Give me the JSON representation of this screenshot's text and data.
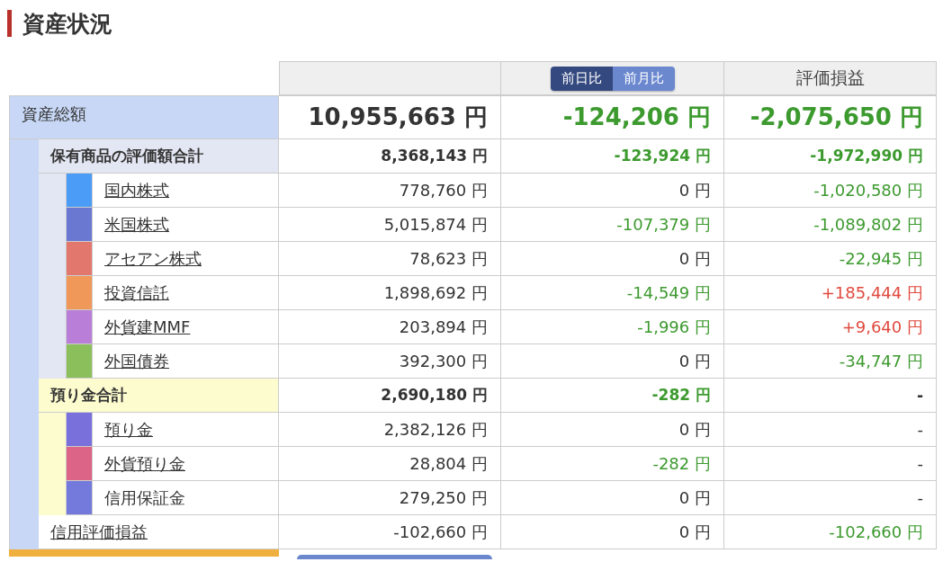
{
  "title": "資産状況",
  "tabs": [
    {
      "label": "前日比",
      "selected": true
    },
    {
      "label": "前月比",
      "selected": false
    }
  ],
  "pnl_header": "評価損益",
  "total": {
    "label": "資産総額",
    "value": "10,955,663 円",
    "change": {
      "text": "-124,206 円",
      "color": "#3d9a2f"
    },
    "pnl": {
      "text": "-2,075,650 円",
      "color": "#3d9a2f"
    },
    "color": "#c7d7f5",
    "children": [
      {
        "kind": "subtotal",
        "label": "保有商品の評価額合計",
        "value": "8,368,143 円",
        "change": {
          "text": "-123,924 円",
          "color": "#3d9a2f"
        },
        "pnl": {
          "text": "-1,972,990 円",
          "color": "#3d9a2f"
        },
        "color": "#e3e7f3",
        "children": [
          {
            "kind": "item",
            "label": "国内株式",
            "link": true,
            "color": "#4a9cf6",
            "value": "778,760 円",
            "change": {
              "text": "0 円",
              "color": "#333333"
            },
            "pnl": {
              "text": "-1,020,580 円",
              "color": "#3d9a2f"
            }
          },
          {
            "kind": "item",
            "label": "米国株式",
            "link": true,
            "color": "#6a78d2",
            "value": "5,015,874 円",
            "change": {
              "text": "-107,379 円",
              "color": "#3d9a2f"
            },
            "pnl": {
              "text": "-1,089,802 円",
              "color": "#3d9a2f"
            }
          },
          {
            "kind": "item",
            "label": "アセアン株式",
            "link": true,
            "color": "#e2776e",
            "value": "78,623 円",
            "change": {
              "text": "0 円",
              "color": "#333333"
            },
            "pnl": {
              "text": "-22,945 円",
              "color": "#3d9a2f"
            }
          },
          {
            "kind": "item",
            "label": "投資信託",
            "link": true,
            "color": "#f0975a",
            "value": "1,898,692 円",
            "change": {
              "text": "-14,549 円",
              "color": "#3d9a2f"
            },
            "pnl": {
              "text": "+185,444 円",
              "color": "#e04a3f"
            }
          },
          {
            "kind": "item",
            "label": "外貨建MMF",
            "link": true,
            "color": "#b97ed8",
            "value": "203,894 円",
            "change": {
              "text": "-1,996 円",
              "color": "#3d9a2f"
            },
            "pnl": {
              "text": "+9,640 円",
              "color": "#e04a3f"
            }
          },
          {
            "kind": "item",
            "label": "外国債券",
            "link": true,
            "color": "#8bbf5c",
            "value": "392,300 円",
            "change": {
              "text": "0 円",
              "color": "#333333"
            },
            "pnl": {
              "text": "-34,747 円",
              "color": "#3d9a2f"
            }
          }
        ]
      },
      {
        "kind": "subtotal",
        "label": "預り金合計",
        "value": "2,690,180 円",
        "change": {
          "text": "-282 円",
          "color": "#3d9a2f"
        },
        "pnl": {
          "text": "-",
          "color": "#333333"
        },
        "color": "#fdfccf",
        "children": [
          {
            "kind": "item",
            "label": "預り金",
            "link": true,
            "color": "#7a70dc",
            "value": "2,382,126 円",
            "change": {
              "text": "0 円",
              "color": "#333333"
            },
            "pnl": {
              "text": "-",
              "color": "#333333"
            }
          },
          {
            "kind": "item",
            "label": "外貨預り金",
            "link": true,
            "color": "#dc6486",
            "value": "28,804 円",
            "change": {
              "text": "-282 円",
              "color": "#3d9a2f"
            },
            "pnl": {
              "text": "-",
              "color": "#333333"
            }
          },
          {
            "kind": "item",
            "label": "信用保証金",
            "link": false,
            "color": "#7479dc",
            "value": "279,250 円",
            "change": {
              "text": "0 円",
              "color": "#333333"
            },
            "pnl": {
              "text": "-",
              "color": "#333333"
            }
          }
        ]
      },
      {
        "kind": "plain",
        "label": "信用評価損益",
        "link": true,
        "value": "-102,660 円",
        "change": {
          "text": "0 円",
          "color": "#333333"
        },
        "pnl": {
          "text": "-102,660 円",
          "color": "#3d9a2f"
        }
      }
    ]
  }
}
